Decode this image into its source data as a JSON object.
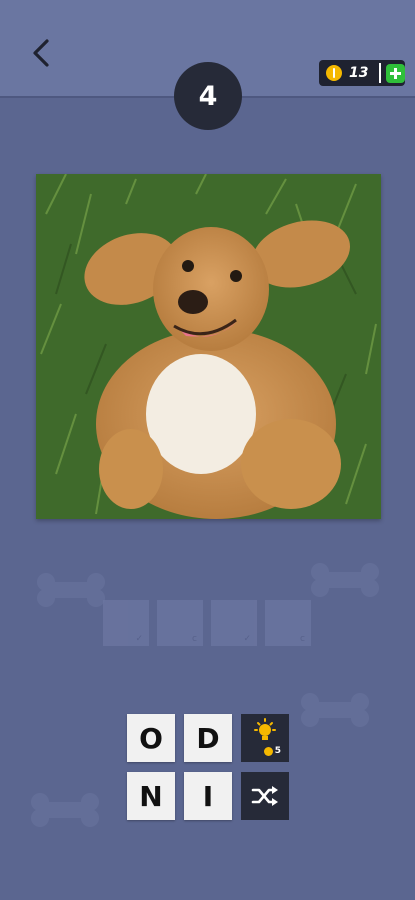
{
  "header": {
    "back_icon": "chevron-left-icon",
    "coins": "13",
    "coin_icon": "coin-icon",
    "add_icon": "plus-icon"
  },
  "level": {
    "number": "4"
  },
  "puzzle": {
    "image": "dog-lying-on-grass",
    "answer_slots": [
      "",
      "",
      "",
      ""
    ]
  },
  "keyboard": {
    "letters": [
      "O",
      "D",
      "N",
      "I"
    ],
    "hint": {
      "icon": "lightbulb-icon",
      "cost": "5"
    },
    "shuffle": {
      "icon": "shuffle-icon"
    }
  },
  "colors": {
    "background": "#5b6690",
    "topbar": "#6a76a1",
    "badge": "#262a38",
    "coin": "#f5b800",
    "add": "#2fbf3a"
  }
}
